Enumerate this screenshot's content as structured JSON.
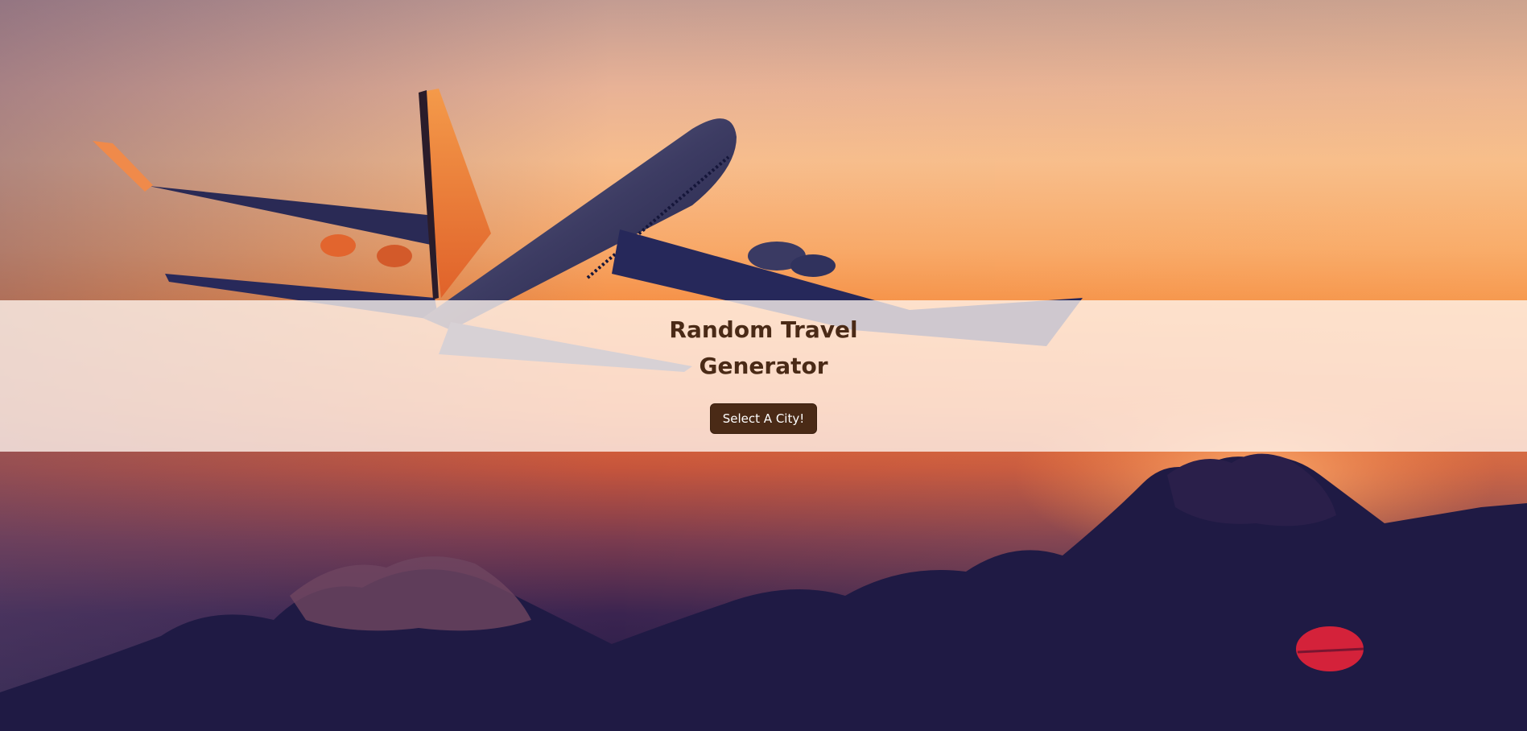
{
  "hero": {
    "title": "Random Travel Generator",
    "button_label": "Select A City!",
    "background": "airplane-sunset-photo"
  },
  "colors": {
    "title": "#4a2a16",
    "button_bg": "#4a2a16",
    "button_text": "#ffffff",
    "band_bg": "#fff6f0"
  }
}
